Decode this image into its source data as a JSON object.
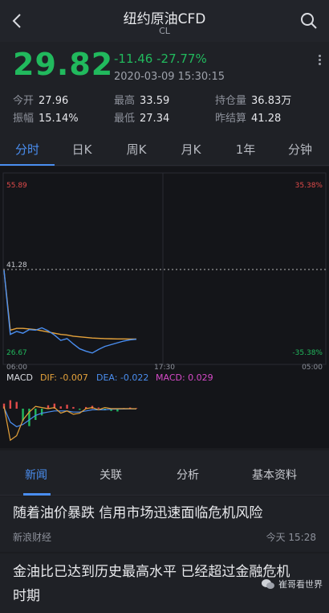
{
  "header": {
    "title": "纽约原油CFD",
    "subtitle": "CL"
  },
  "quote": {
    "price": "29.82",
    "change": "-11.46 -27.77%",
    "timestamp": "2020-03-09 15:30:15",
    "stats": [
      {
        "label": "今开",
        "value": "27.96"
      },
      {
        "label": "最高",
        "value": "33.59"
      },
      {
        "label": "持仓量",
        "value": "36.83万"
      },
      {
        "label": "振幅",
        "value": "15.14%"
      },
      {
        "label": "最低",
        "value": "27.34"
      },
      {
        "label": "昨结算",
        "value": "41.28"
      }
    ]
  },
  "tabs": [
    "分时",
    "日K",
    "周K",
    "月K",
    "1年",
    "分钟"
  ],
  "chart_data": {
    "type": "line",
    "y_top_left": "55.89",
    "y_top_right": "35.38%",
    "y_mid": "41.28",
    "y_bottom_left": "26.67",
    "y_bottom_right": "-35.38%",
    "x_labels": [
      "06:00",
      "17:30",
      "05:00"
    ],
    "ylim": [
      26.67,
      55.89
    ],
    "prev_settle": 41.28,
    "price_series": [
      41.28,
      30.6,
      31.1,
      30.8,
      31.4,
      31.3,
      31.7,
      31.2,
      30.5,
      29.6,
      29.9,
      29.0,
      28.2,
      27.8,
      27.5,
      28.1,
      28.6,
      28.9,
      29.2,
      29.5,
      29.7,
      29.8
    ],
    "avg_series": [
      41.28,
      31.3,
      31.6,
      31.6,
      31.5,
      31.4,
      31.2,
      31.0,
      30.8,
      30.6,
      30.5,
      30.3,
      30.2,
      30.1,
      30.0,
      29.95,
      29.9,
      29.87,
      29.85,
      29.84,
      29.83,
      29.82
    ],
    "macd": {
      "dif_label": "DIF: -0.007",
      "dea_label": "DEA: -0.022",
      "macd_label": "MACD: 0.029",
      "bars": [
        0.9,
        1.5,
        1.2,
        -2.2,
        -3.1,
        -2.0,
        -1.2,
        0.6,
        0.9,
        0.4,
        0.7,
        0.3,
        -0.2,
        0.3,
        0.5,
        0.2,
        -0.3,
        -0.4,
        -0.5,
        0.1,
        0.2,
        0.1
      ],
      "dif": [
        0.2,
        -2.8,
        -2.4,
        -1.0,
        -0.3,
        0.2,
        0.1,
        0.0,
        0.1,
        -0.4,
        -0.2,
        -0.5,
        -0.4,
        0.0,
        0.1,
        -0.1,
        0.1,
        0.0,
        0.0,
        0.0,
        0.0,
        -0.01
      ],
      "dea": [
        0.1,
        -1.2,
        -1.6,
        -1.4,
        -1.0,
        -0.6,
        -0.4,
        -0.3,
        -0.2,
        -0.2,
        -0.2,
        -0.3,
        -0.3,
        -0.2,
        -0.1,
        -0.1,
        -0.1,
        -0.05,
        -0.04,
        -0.03,
        -0.02,
        -0.02
      ]
    }
  },
  "news_tabs": [
    "新闻",
    "关联",
    "分析",
    "基本资料"
  ],
  "news": [
    {
      "title": "随着油价暴跌 信用市场迅速面临危机风险",
      "source": "新浪财经",
      "time": "今天 15:28"
    },
    {
      "title_line1": "金油比已达到历史最高水平 已经超过金融危机",
      "title_line2": "时期"
    }
  ],
  "watermark": "崔哥看世界",
  "colors": {
    "green": "#21b95d",
    "red": "#e04a4a",
    "blue": "#4a8ef0",
    "orange": "#e5a23b",
    "magenta": "#d64ac8"
  }
}
